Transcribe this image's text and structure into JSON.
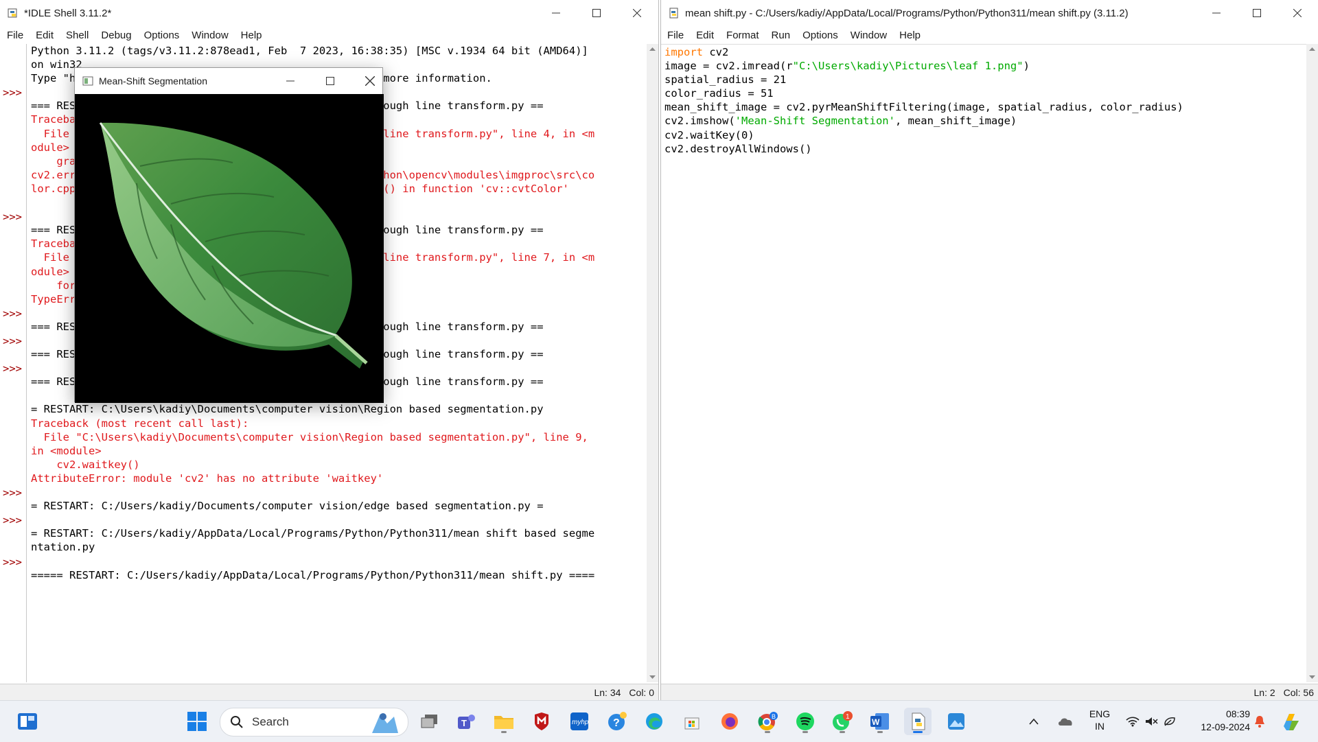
{
  "shell": {
    "title": "*IDLE Shell 3.11.2*",
    "menu": [
      "File",
      "Edit",
      "Shell",
      "Debug",
      "Options",
      "Window",
      "Help"
    ],
    "status": {
      "ln": "Ln: 34",
      "col": "Col: 0"
    },
    "prompt": ">>>",
    "lines": [
      {
        "t": "Python 3.11.2 (tags/v3.11.2:878ead1, Feb  7 2023, 16:38:35) [MSC v.1934 64 bit (AMD64)]",
        "c": "blk"
      },
      {
        "t": "on win32",
        "c": "blk"
      },
      {
        "t": "Type \"help\", \"copyright\", \"credits\" or \"license()\" for more information.",
        "c": "blk"
      },
      {
        "t": "",
        "c": "blk"
      },
      {
        "t": "=== RESTART: C:/Users/kadiy/Documents/computer vision/hough line transform.py ==",
        "c": "blk"
      },
      {
        "t": "Traceback (most recent call last):",
        "c": "red"
      },
      {
        "t": "  File \"C:/Users/kadiy/Documents/computer vision/hough line transform.py\", line 4, in <m",
        "c": "red"
      },
      {
        "t": "odule>",
        "c": "red"
      },
      {
        "t": "    gray = cv2.cvtColor(image, cv2.COLOR_BGR2GRAY)",
        "c": "red"
      },
      {
        "t": "cv2.error: OpenCV(4.10.0) D:\\a\\opencv-python\\opencv-python\\opencv\\modules\\imgproc\\src\\co",
        "c": "red"
      },
      {
        "t": "lor.cpp:196: error: (-215:Assertion failed) !_src.empty() in function 'cv::cvtColor'",
        "c": "red"
      },
      {
        "t": "",
        "c": "blk"
      },
      {
        "t": "",
        "c": "blk"
      },
      {
        "t": "=== RESTART: C:/Users/kadiy/Documents/computer vision/hough line transform.py ==",
        "c": "blk"
      },
      {
        "t": "Traceback (most recent call last):",
        "c": "red"
      },
      {
        "t": "  File \"C:/Users/kadiy/Documents/computer vision/hough line transform.py\", line 7, in <m",
        "c": "red"
      },
      {
        "t": "odule>",
        "c": "red"
      },
      {
        "t": "    for line in lines:",
        "c": "red"
      },
      {
        "t": "TypeError: 'NoneType' object is not iterable",
        "c": "red"
      },
      {
        "t": "",
        "c": "blk"
      },
      {
        "t": "=== RESTART: C:/Users/kadiy/Documents/computer vision/hough line transform.py ==",
        "c": "blk"
      },
      {
        "t": "",
        "c": "blk"
      },
      {
        "t": "=== RESTART: C:/Users/kadiy/Documents/computer vision/hough line transform.py ==",
        "c": "blk"
      },
      {
        "t": "",
        "c": "blk"
      },
      {
        "t": "=== RESTART: C:/Users/kadiy/Documents/computer vision/hough line transform.py ==",
        "c": "blk"
      },
      {
        "t": "",
        "c": "blk"
      },
      {
        "t": "= RESTART: C:\\Users\\kadiy\\Documents\\computer vision\\Region based segmentation.py",
        "c": "blk"
      },
      {
        "t": "Traceback (most recent call last):",
        "c": "red"
      },
      {
        "t": "  File \"C:\\Users\\kadiy\\Documents\\computer vision\\Region based segmentation.py\", line 9,",
        "c": "red"
      },
      {
        "t": "in <module>",
        "c": "red"
      },
      {
        "t": "    cv2.waitkey()",
        "c": "red"
      },
      {
        "t": "AttributeError: module 'cv2' has no attribute 'waitkey'",
        "c": "red"
      },
      {
        "t": "",
        "c": "blk"
      },
      {
        "t": "= RESTART: C:/Users/kadiy/Documents/computer vision/edge based segmentation.py =",
        "c": "blk"
      },
      {
        "t": "",
        "c": "blk"
      },
      {
        "t": "= RESTART: C:/Users/kadiy/AppData/Local/Programs/Python/Python311/mean shift based segme",
        "c": "blk"
      },
      {
        "t": "ntation.py",
        "c": "blk"
      },
      {
        "t": "",
        "c": "blk"
      },
      {
        "t": "===== RESTART: C:/Users/kadiy/AppData/Local/Programs/Python/Python311/mean shift.py ====",
        "c": "blk"
      }
    ],
    "prompt_lines": [
      3,
      12,
      19,
      21,
      23,
      32,
      34,
      37
    ]
  },
  "editor": {
    "title": "mean shift.py - C:/Users/kadiy/AppData/Local/Programs/Python/Python311/mean shift.py (3.11.2)",
    "menu": [
      "File",
      "Edit",
      "Format",
      "Run",
      "Options",
      "Window",
      "Help"
    ],
    "status": {
      "ln": "Ln: 2",
      "col": "Col: 56"
    },
    "code": [
      [
        {
          "t": "import",
          "c": "kw"
        },
        {
          "t": " cv2",
          "c": "blk"
        }
      ],
      [
        {
          "t": "image = cv2.imread(r",
          "c": "blk"
        },
        {
          "t": "\"C:\\Users\\kadiy\\Pictures\\leaf 1.png\"",
          "c": "str"
        },
        {
          "t": ")",
          "c": "blk"
        }
      ],
      [
        {
          "t": "spatial_radius = 21",
          "c": "blk"
        }
      ],
      [
        {
          "t": "color_radius = 51",
          "c": "blk"
        }
      ],
      [
        {
          "t": "mean_shift_image = cv2.pyrMeanShiftFiltering(image, spatial_radius, color_radius)",
          "c": "blk"
        }
      ],
      [
        {
          "t": "cv2.imshow(",
          "c": "blk"
        },
        {
          "t": "'Mean-Shift Segmentation'",
          "c": "str"
        },
        {
          "t": ", mean_shift_image)",
          "c": "blk"
        }
      ],
      [
        {
          "t": "cv2.waitKey(0)",
          "c": "blk"
        }
      ],
      [
        {
          "t": "cv2.destroyAllWindows()",
          "c": "blk"
        }
      ]
    ]
  },
  "popup": {
    "title": "Mean-Shift Segmentation"
  },
  "taskbar": {
    "search_label": "Search",
    "lang_top": "ENG",
    "lang_bottom": "IN",
    "time": "08:39",
    "date": "12-09-2024",
    "teams_badge": "",
    "whatsapp_badge": "1",
    "chrome_badge": "B"
  },
  "colors": {
    "error": "#e0191d",
    "keyword": "#ff7700",
    "string": "#00aa00",
    "prompt": "#a00000"
  }
}
